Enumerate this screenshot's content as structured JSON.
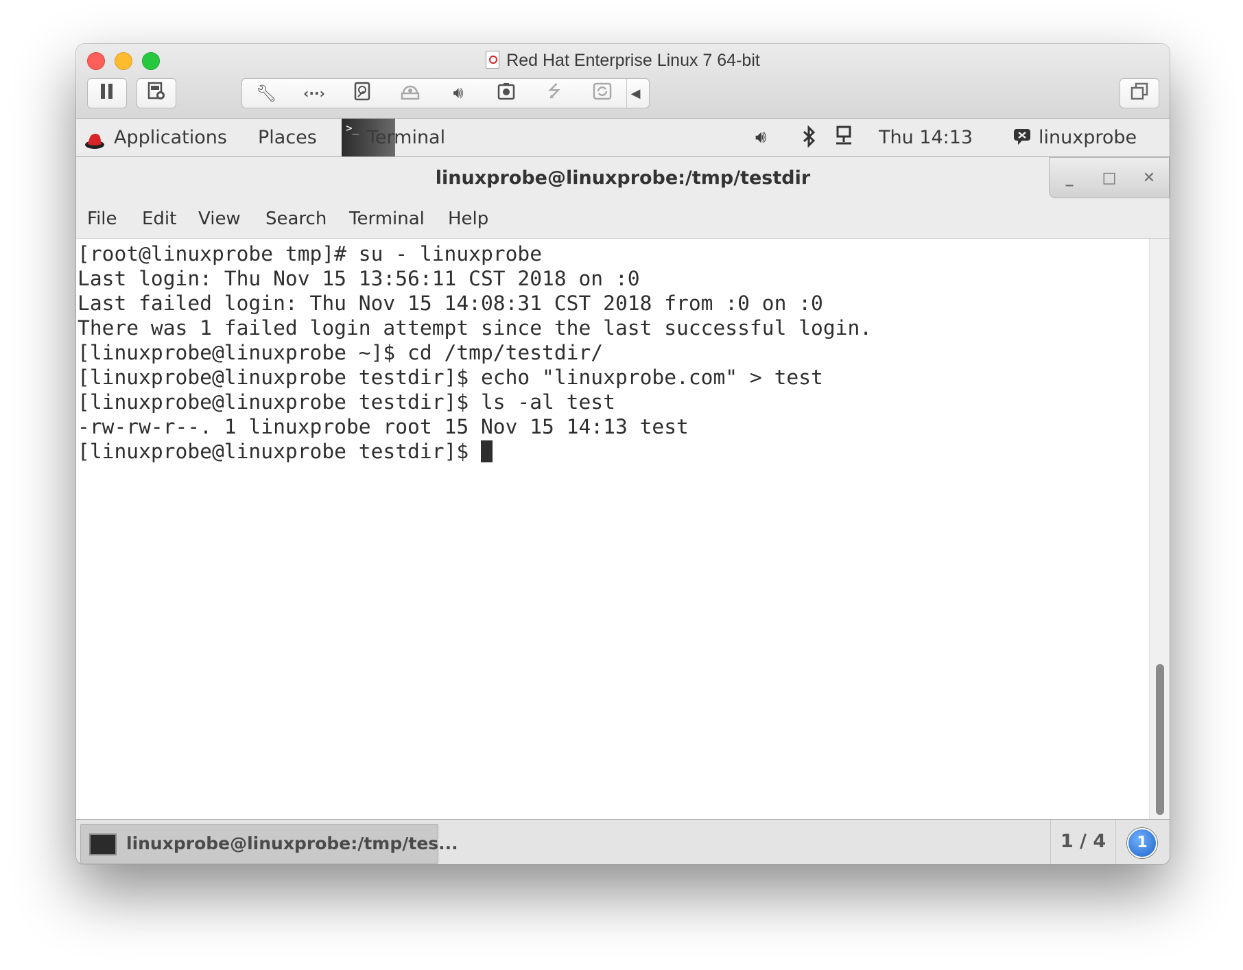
{
  "vm_window": {
    "title": "Red Hat Enterprise Linux 7 64-bit",
    "toolbar_icons": [
      "pause-icon",
      "snapshot-icon",
      "wrench-icon",
      "code-arrows-icon",
      "disk-icon",
      "drive-icon",
      "speaker-icon",
      "camera-icon",
      "usb-icon",
      "refresh-icon",
      "arrow-left-icon",
      "fullscreen-icon"
    ]
  },
  "gnome_topbar": {
    "applications": "Applications",
    "places": "Places",
    "active_app": "Terminal",
    "clock": "Thu 14:13",
    "user": "linuxprobe"
  },
  "terminal": {
    "title": "linuxprobe@linuxprobe:/tmp/testdir",
    "menu": [
      "File",
      "Edit",
      "View",
      "Search",
      "Terminal",
      "Help"
    ],
    "lines": [
      "[root@linuxprobe tmp]# su - linuxprobe",
      "Last login: Thu Nov 15 13:56:11 CST 2018 on :0",
      "Last failed login: Thu Nov 15 14:08:31 CST 2018 from :0 on :0",
      "There was 1 failed login attempt since the last successful login.",
      "[linuxprobe@linuxprobe ~]$ cd /tmp/testdir/",
      "[linuxprobe@linuxprobe testdir]$ echo \"linuxprobe.com\" > test",
      "[linuxprobe@linuxprobe testdir]$ ls -al test",
      "-rw-rw-r--. 1 linuxprobe root 15 Nov 15 14:13 test"
    ],
    "prompt": "[linuxprobe@linuxprobe testdir]$ "
  },
  "taskbar": {
    "task_label": "linuxprobe@linuxprobe:/tmp/tes...",
    "workspace": "1 / 4",
    "notification_count": "1"
  }
}
